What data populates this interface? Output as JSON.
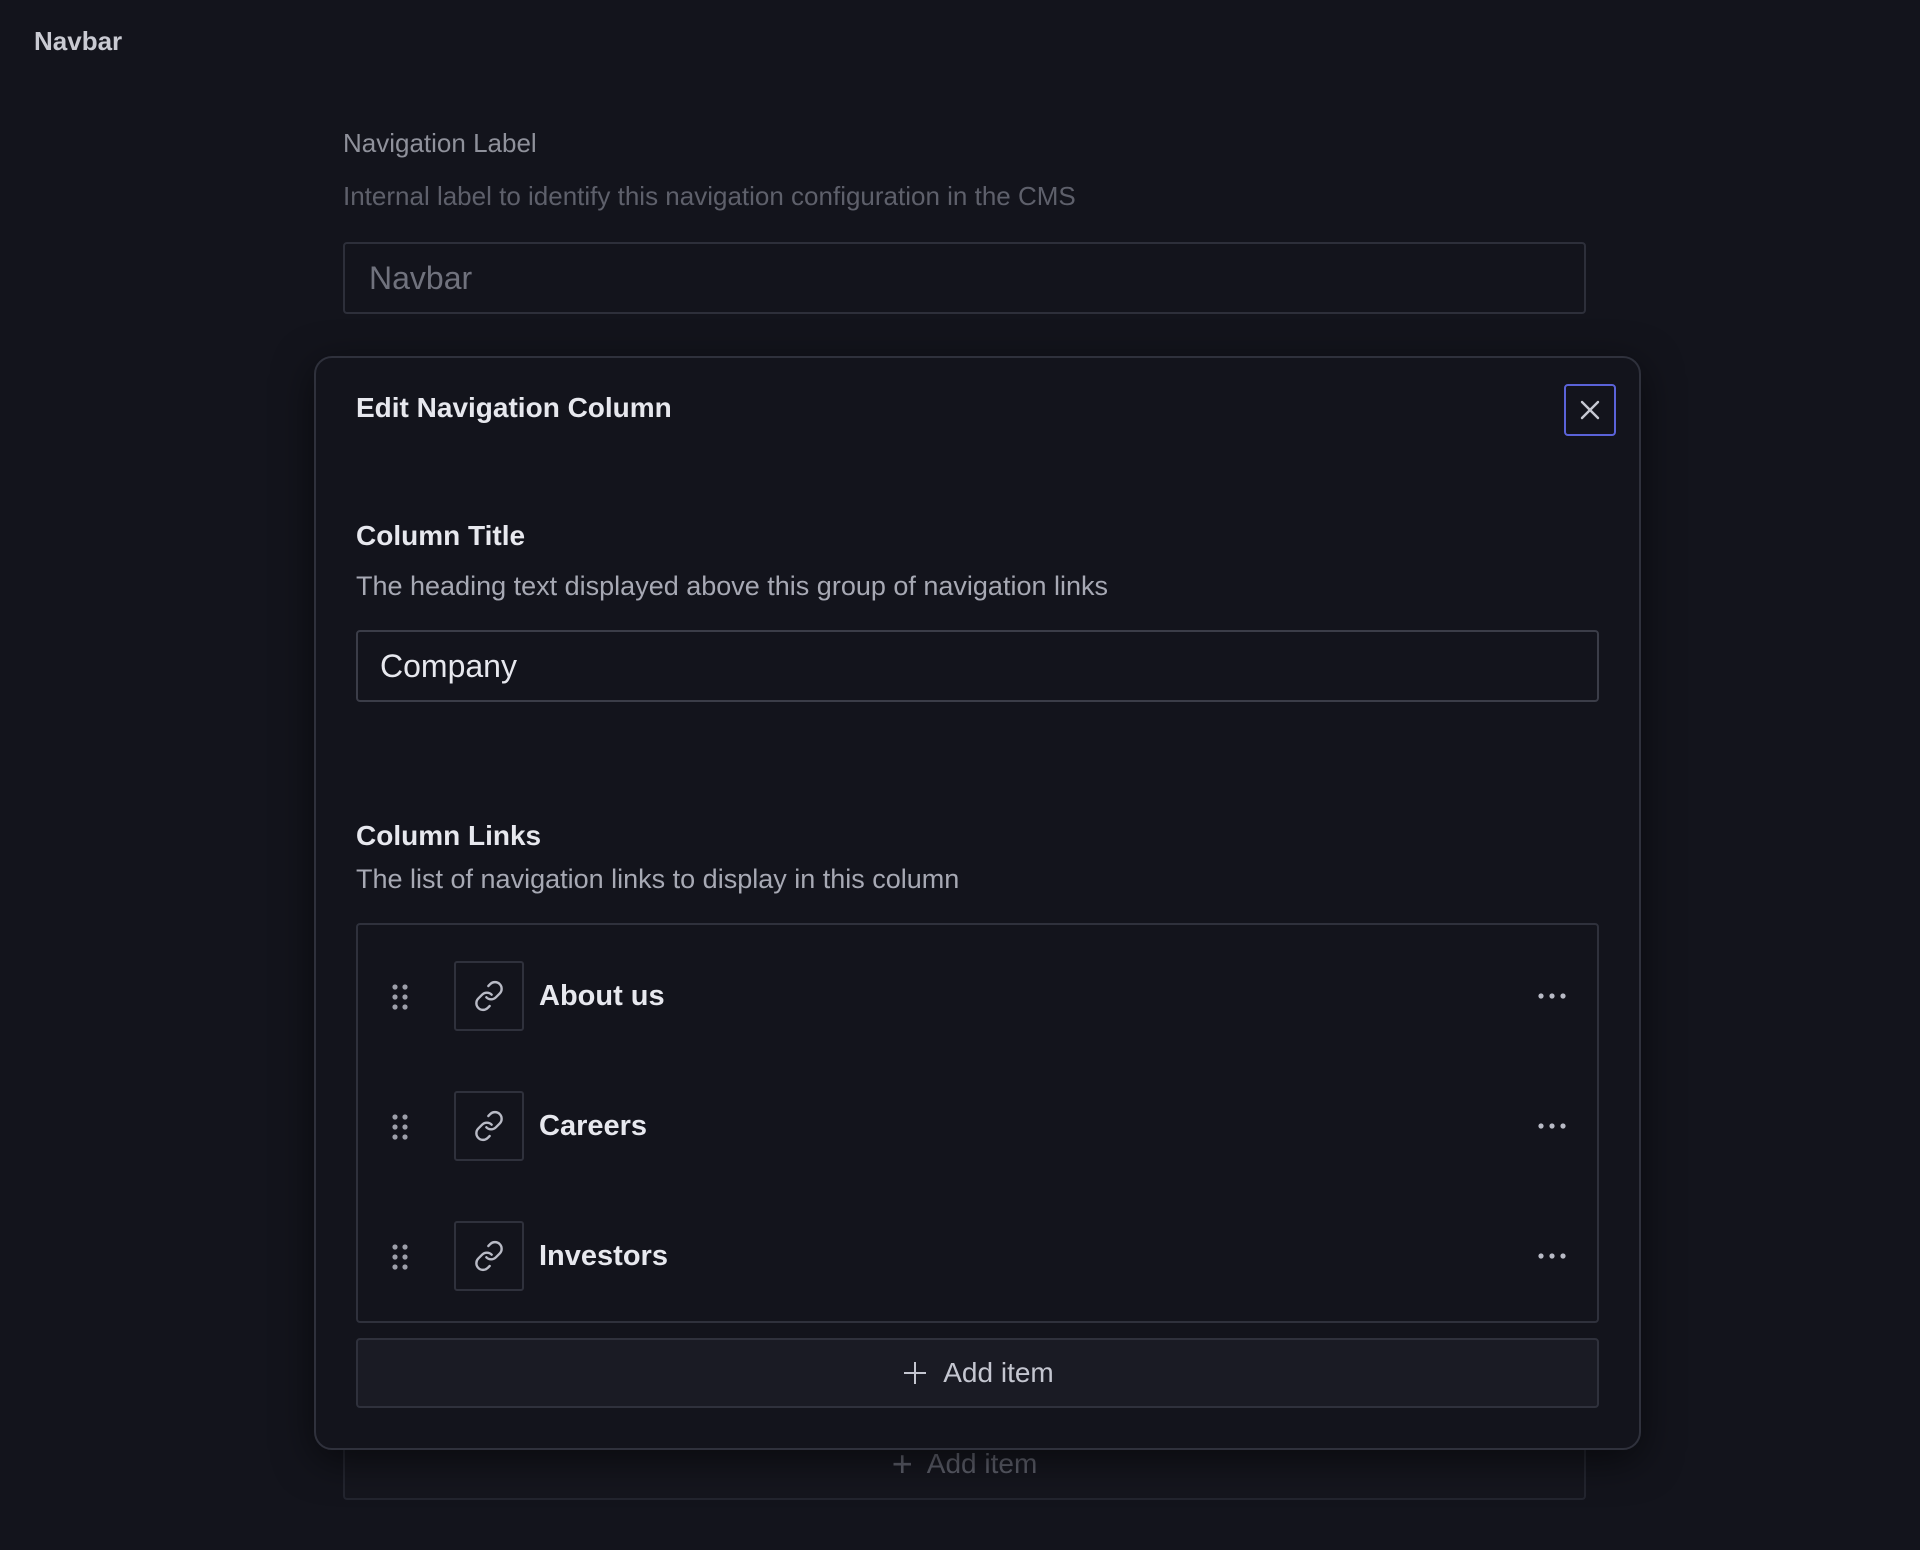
{
  "document": {
    "title": "Navbar"
  },
  "background_form": {
    "label": "Navigation Label",
    "description": "Internal label to identify this navigation configuration in the CMS",
    "input_value": "Navbar",
    "add_item_label": "Add item"
  },
  "dialog": {
    "title": "Edit Navigation Column",
    "close_icon": "close-icon",
    "column_title": {
      "label": "Column Title",
      "description": "The heading text displayed above this group of navigation links",
      "value": "Company"
    },
    "column_links": {
      "label": "Column Links",
      "description": "The list of navigation links to display in this column",
      "items": [
        {
          "label": "About us",
          "icon": "link-icon"
        },
        {
          "label": "Careers",
          "icon": "link-icon"
        },
        {
          "label": "Investors",
          "icon": "link-icon"
        }
      ],
      "add_item_label": "Add item"
    }
  },
  "colors": {
    "background": "#13141c",
    "focus_accent": "#5b63d8",
    "border": "#2f313c"
  }
}
